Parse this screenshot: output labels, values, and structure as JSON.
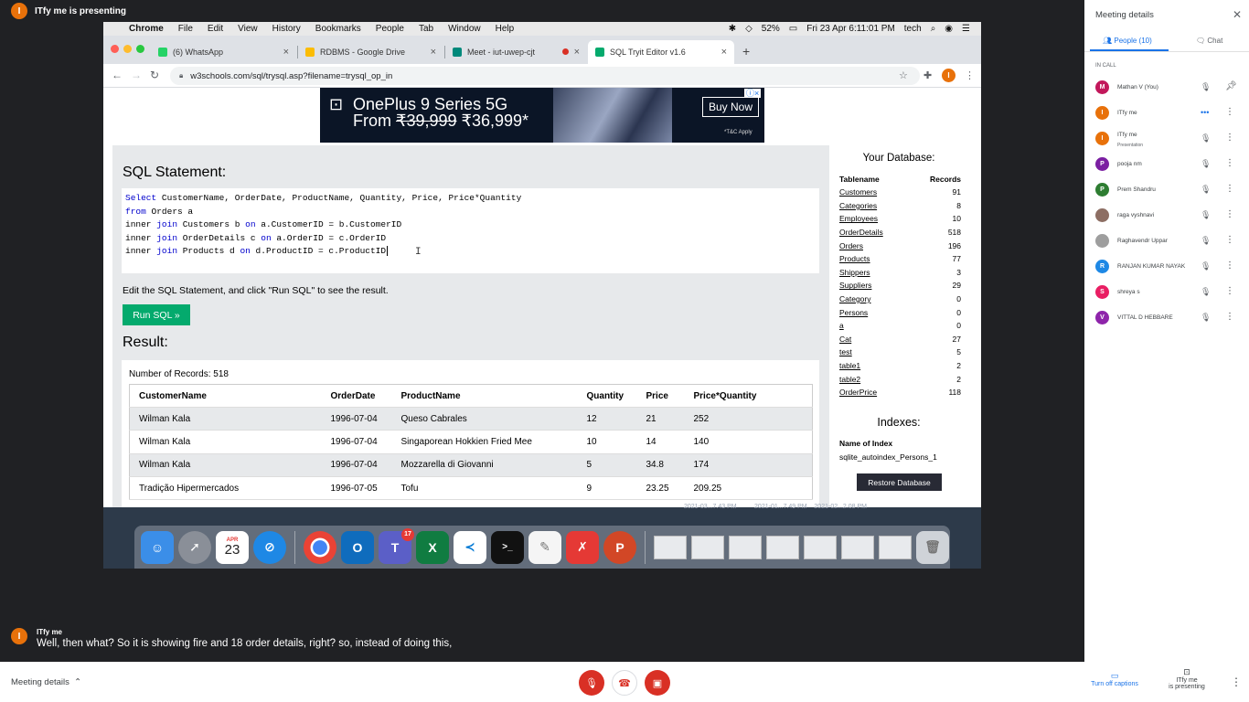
{
  "presenter": {
    "initial": "I",
    "label": "ITfy me is presenting"
  },
  "mac": {
    "menu": [
      "Chrome",
      "File",
      "Edit",
      "View",
      "History",
      "Bookmarks",
      "People",
      "Tab",
      "Window",
      "Help"
    ],
    "battery": "52%",
    "datetime": "Fri 23 Apr  6:11:01 PM",
    "user": "tech"
  },
  "browser": {
    "tabs": [
      {
        "label": "(6) WhatsApp",
        "color": "#25d366"
      },
      {
        "label": "RDBMS - Google Drive",
        "color": "#fbbc04"
      },
      {
        "label": "Meet - iut-uwep-cjt",
        "color": "#00897b"
      },
      {
        "label": "SQL Tryit Editor v1.6",
        "color": "#04aa6d"
      }
    ],
    "url": "w3schools.com/sql/trysql.asp?filename=trysql_op_in",
    "profile_initial": "I"
  },
  "ad": {
    "line1": "OnePlus 9 Series 5G",
    "from": "From",
    "old_price": "₹39,999",
    "new_price": "₹36,999*",
    "cta": "Buy Now",
    "tnc": "*T&C Apply"
  },
  "editor": {
    "heading": "SQL Statement:",
    "instruction": "Edit the SQL Statement, and click \"Run SQL\" to see the result.",
    "run_label": "Run SQL »",
    "result_heading": "Result:",
    "record_count": "Number of Records: 518"
  },
  "result": {
    "columns": [
      "CustomerName",
      "OrderDate",
      "ProductName",
      "Quantity",
      "Price",
      "Price*Quantity"
    ],
    "rows": [
      [
        "Wilman Kala",
        "1996-07-04",
        "Queso Cabrales",
        "12",
        "21",
        "252"
      ],
      [
        "Wilman Kala",
        "1996-07-04",
        "Singaporean Hokkien Fried Mee",
        "10",
        "14",
        "140"
      ],
      [
        "Wilman Kala",
        "1996-07-04",
        "Mozzarella di Giovanni",
        "5",
        "34.8",
        "174"
      ],
      [
        "Tradição Hipermercados",
        "1996-07-05",
        "Tofu",
        "9",
        "23.25",
        "209.25"
      ]
    ]
  },
  "database": {
    "heading": "Your Database:",
    "col_table": "Tablename",
    "col_records": "Records",
    "tables": [
      [
        "Customers",
        "91"
      ],
      [
        "Categories",
        "8"
      ],
      [
        "Employees",
        "10"
      ],
      [
        "OrderDetails",
        "518"
      ],
      [
        "Orders",
        "196"
      ],
      [
        "Products",
        "77"
      ],
      [
        "Shippers",
        "3"
      ],
      [
        "Suppliers",
        "29"
      ],
      [
        "Category",
        "0"
      ],
      [
        "Persons",
        "0"
      ],
      [
        "a",
        "0"
      ],
      [
        "Cat",
        "27"
      ],
      [
        "test",
        "5"
      ],
      [
        "table1",
        "2"
      ],
      [
        "table2",
        "2"
      ],
      [
        "OrderPrice",
        "118"
      ]
    ],
    "indexes_heading": "Indexes:",
    "index_col": "Name of Index",
    "index_value": "sqlite_autoindex_Persons_1",
    "restore_label": "Restore Database"
  },
  "desktop": {
    "dates": "2021-03...7.43 PM          2021-01...7.49 PM    2021-02...2.08 PM",
    "teams_badge": "17",
    "calendar_month": "APR",
    "calendar_day": "23"
  },
  "caption": {
    "initial": "I",
    "speaker": "ITfy me",
    "text": "Well, then what? So it is showing fire and 18 order details, right? so, instead of doing this,"
  },
  "bottombar": {
    "meeting_details": "Meeting details",
    "captions_label": "Turn off captions",
    "present_line1": "ITfy me",
    "present_line2": "is presenting"
  },
  "sidepanel": {
    "title": "Meeting details",
    "people_tab": "People (10)",
    "chat_tab": "Chat",
    "in_call": "IN CALL",
    "participants": [
      {
        "initial": "M",
        "name": "Mathan V (You)",
        "sub": "",
        "color": "#c2185b"
      },
      {
        "initial": "I",
        "name": "ITfy me",
        "sub": "",
        "color": "#e8710a"
      },
      {
        "initial": "I",
        "name": "ITfy me",
        "sub": "Presentation",
        "color": "#e8710a"
      },
      {
        "initial": "P",
        "name": "pooja nm",
        "sub": "",
        "color": "#7b1fa2"
      },
      {
        "initial": "P",
        "name": "Prem Shandru",
        "sub": "",
        "color": "#2e7d32"
      },
      {
        "initial": "",
        "name": "raga vyshnavi",
        "sub": "",
        "color": "#8d6e63"
      },
      {
        "initial": "",
        "name": "Raghavendr Uppar",
        "sub": "",
        "color": "#9e9e9e"
      },
      {
        "initial": "R",
        "name": "RANJAN KUMAR NAYAK",
        "sub": "",
        "color": "#1e88e5"
      },
      {
        "initial": "S",
        "name": "shreya s",
        "sub": "",
        "color": "#e91e63"
      },
      {
        "initial": "V",
        "name": "VITTAL D HEBBARE",
        "sub": "",
        "color": "#8e24aa"
      }
    ]
  }
}
